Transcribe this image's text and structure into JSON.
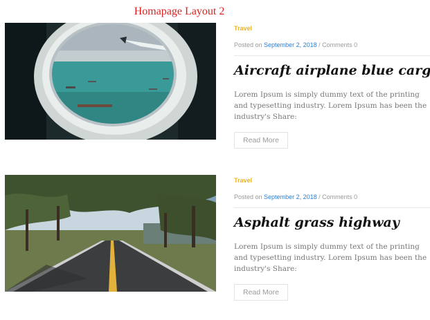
{
  "page": {
    "heading": "Homapage Layout 2"
  },
  "posts": [
    {
      "category": "Travel",
      "posted_prefix": "Posted on",
      "date": "September 2, 2018",
      "separator": "/",
      "comments": "Comments 0",
      "title": "Aircraft airplane blue cargo",
      "excerpt": "Lorem Ipsum is simply dummy text of the printing and typesetting industry. Lorem Ipsum has been the industry's Share:",
      "read_more": "Read More",
      "image": "airplane-window-photo"
    },
    {
      "category": "Travel",
      "posted_prefix": "Posted on",
      "date": "September 2, 2018",
      "separator": "/",
      "comments": "Comments 0",
      "title": "Asphalt grass highway",
      "excerpt": "Lorem Ipsum is simply dummy text of the printing and typesetting industry. Lorem Ipsum has been the industry's Share:",
      "read_more": "Read More",
      "image": "tree-lined-road-photo"
    }
  ],
  "colors": {
    "heading": "#e21f1f",
    "category": "#e8b32a",
    "date_link": "#2a7fd4",
    "meta_text": "#9a9a9a"
  }
}
